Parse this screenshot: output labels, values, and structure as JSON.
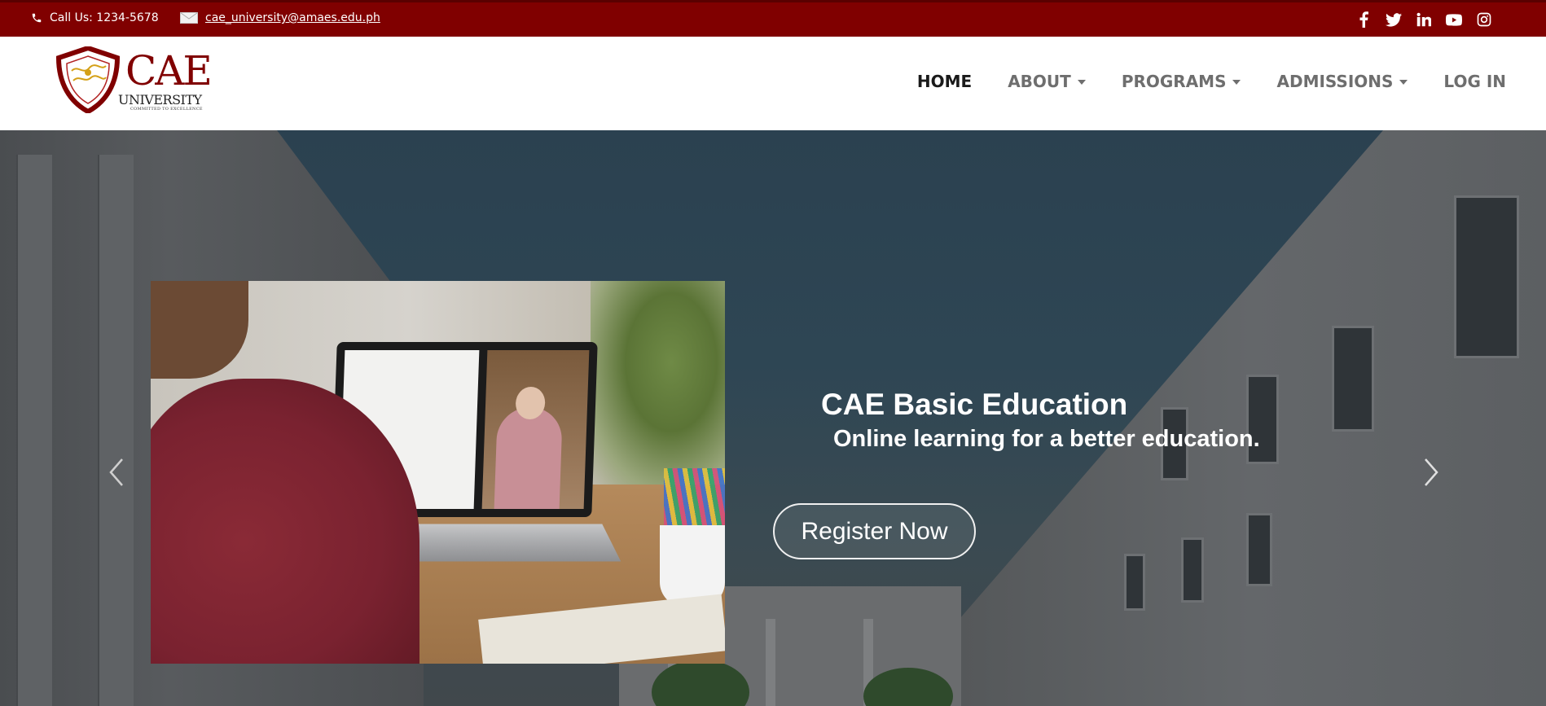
{
  "topbar": {
    "phone_text": "Call Us: 1234-5678",
    "email_text": "cae_university@amaes.edu.ph",
    "phone_icon": "phone-icon",
    "email_icon": "envelope-icon",
    "socials": [
      "facebook-icon",
      "twitter-icon",
      "linkedin-icon",
      "youtube-icon",
      "instagram-icon"
    ],
    "background_color": "#800000"
  },
  "logo": {
    "main": "CAE",
    "sub": "UNIVERSITY",
    "tagline": "COMMITTED TO EXCELLENCE",
    "brand_color": "#800000"
  },
  "nav": {
    "home": "HOME",
    "about": "ABOUT",
    "programs": "PROGRAMS",
    "admissions": "ADMISSIONS",
    "login": "LOG IN"
  },
  "hero": {
    "title": "CAE Basic Education",
    "subtitle": "Online learning for a better education.",
    "button": "Register Now",
    "prev_icon": "chevron-left-icon",
    "next_icon": "chevron-right-icon"
  }
}
